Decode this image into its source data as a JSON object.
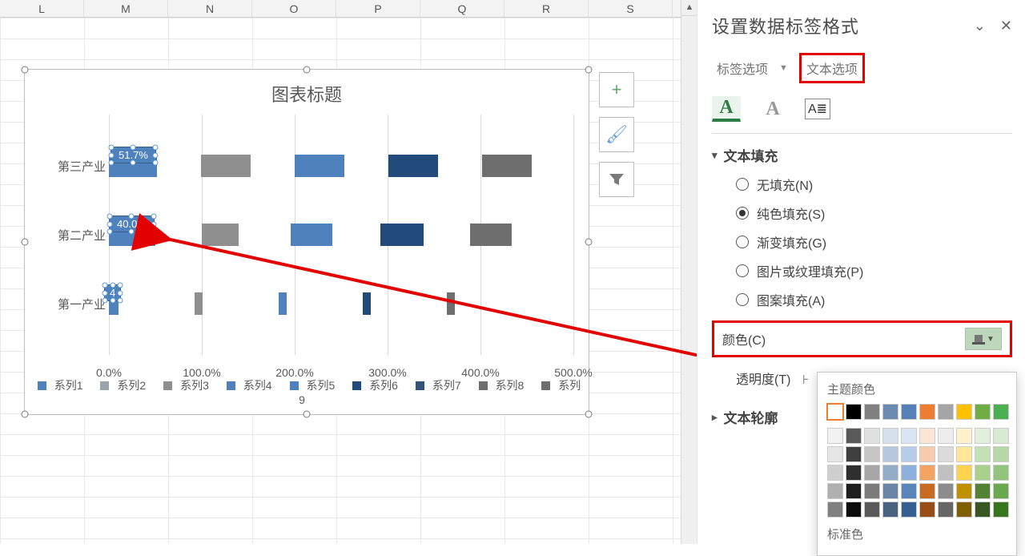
{
  "columns": [
    "L",
    "M",
    "N",
    "O",
    "P",
    "Q",
    "R",
    "S"
  ],
  "chart": {
    "title": "图表标题",
    "categories": [
      "第三产业",
      "第二产业",
      "第一产业"
    ],
    "x_ticks": [
      "0.0%",
      "100.0%",
      "200.0%",
      "300.0%",
      "400.0%",
      "500.0%"
    ],
    "legend": [
      "系列1",
      "系列2",
      "系列3",
      "系列4",
      "系列5",
      "系列6",
      "系列7",
      "系列8",
      "系列9"
    ],
    "legend_colors": [
      "#4f81bd",
      "#9aa4ae",
      "#8f8f8f",
      "#4f81bd",
      "#4f81bd",
      "#224a7a",
      "#31537b",
      "#6e6e6e",
      "#6e6e6e"
    ],
    "bars": {
      "row0": [
        60,
        62,
        62,
        62,
        62
      ],
      "row1": [
        58,
        46,
        52,
        54,
        52
      ],
      "row2": [
        12,
        10,
        10,
        10,
        10
      ]
    },
    "bar_colors": [
      "#4f81bd",
      "#8f8f8f",
      "#4f81bd",
      "#224a7a",
      "#6e6e6e"
    ],
    "data_labels": {
      "0": "51.7%",
      "1": "40.0%",
      "2": "4"
    }
  },
  "chart_side": {
    "plus": "+",
    "brush": "🖌",
    "funnel": "▼"
  },
  "pane": {
    "title": "设置数据标签格式",
    "collapse": "⌄",
    "close": "✕",
    "tab1": "标签选项",
    "tab2": "文本选项",
    "icons": {
      "fill": "A",
      "outline": "A",
      "textbox": "A≣"
    },
    "section_fill": "文本填充",
    "opt_none": "无填充(N)",
    "opt_solid": "纯色填充(S)",
    "opt_grad": "渐变填充(G)",
    "opt_pic": "图片或纹理填充(P)",
    "opt_pattern": "图案填充(A)",
    "color_label": "颜色(C)",
    "transparency": "透明度(T)",
    "section_outline": "文本轮廓"
  },
  "color_picker": {
    "title_theme": "主题颜色",
    "title_std": "标准色",
    "theme_row1": [
      "#ffffff",
      "#000000",
      "#808080",
      "#6b8ab0",
      "#577fb8",
      "#ed7d31",
      "#a5a5a5",
      "#ffc000",
      "#70ad47",
      "#4caf50"
    ],
    "theme_shades": [
      [
        "#f2f2f2",
        "#e6e6e6",
        "#cfcfcf",
        "#b0b0b0",
        "#808080"
      ],
      [
        "#595959",
        "#3f3f3f",
        "#2f2f2f",
        "#1f1f1f",
        "#0d0d0d"
      ],
      [
        "#e0e0e0",
        "#c6c6c6",
        "#a6a6a6",
        "#7b7b7b",
        "#5a5a5a"
      ],
      [
        "#d6e0ec",
        "#b7c8de",
        "#93acc8",
        "#6986a8",
        "#46627f"
      ],
      [
        "#dbe5f1",
        "#b8ccea",
        "#8eb0dd",
        "#5a85bb",
        "#365f91"
      ],
      [
        "#fbe5d6",
        "#f7cbac",
        "#f4a460",
        "#c96a21",
        "#974d14"
      ],
      [
        "#ededed",
        "#dbdbdb",
        "#c0c0c0",
        "#8c8c8c",
        "#666666"
      ],
      [
        "#fff2cc",
        "#ffe699",
        "#ffd34d",
        "#bf9000",
        "#7f6000"
      ],
      [
        "#e2efda",
        "#c5e0b4",
        "#a9d18e",
        "#548235",
        "#375623"
      ],
      [
        "#d9ead3",
        "#b6d7a8",
        "#93c47d",
        "#6aa84f",
        "#38761d"
      ]
    ],
    "standard": [
      "#c00000",
      "#ff0000",
      "#ffc000",
      "#ffff00",
      "#92d050",
      "#00b050",
      "#00b0f0",
      "#0070c0",
      "#002060",
      "#7030a0"
    ]
  },
  "chart_data": {
    "type": "bar",
    "orientation": "horizontal",
    "title": "图表标题",
    "categories": [
      "第三产业",
      "第二产业",
      "第一产业"
    ],
    "xlabel": "",
    "ylabel": "",
    "xlim": [
      0,
      500
    ],
    "x_tick_format": "percent_1dp",
    "series": [
      {
        "name": "系列1",
        "values": [
          51.7,
          40.0,
          4.0
        ],
        "color": "#4f81bd",
        "data_labels": [
          "51.7%",
          "40.0%",
          "4"
        ]
      },
      {
        "name": "系列2",
        "values": [
          50,
          38,
          8
        ],
        "color": "#9aa4ae"
      },
      {
        "name": "系列3",
        "values": [
          50,
          38,
          8
        ],
        "color": "#8f8f8f"
      },
      {
        "name": "系列4",
        "values": [
          50,
          40,
          8
        ],
        "color": "#4f81bd"
      },
      {
        "name": "系列5",
        "values": [
          50,
          40,
          8
        ],
        "color": "#4f81bd"
      },
      {
        "name": "系列6",
        "values": [
          50,
          42,
          8
        ],
        "color": "#224a7a"
      },
      {
        "name": "系列7",
        "values": [
          50,
          42,
          8
        ],
        "color": "#31537b"
      },
      {
        "name": "系列8",
        "values": [
          50,
          40,
          8
        ],
        "color": "#6e6e6e"
      },
      {
        "name": "系列9",
        "values": [
          50,
          40,
          8
        ],
        "color": "#6e6e6e"
      }
    ],
    "legend_position": "bottom"
  }
}
